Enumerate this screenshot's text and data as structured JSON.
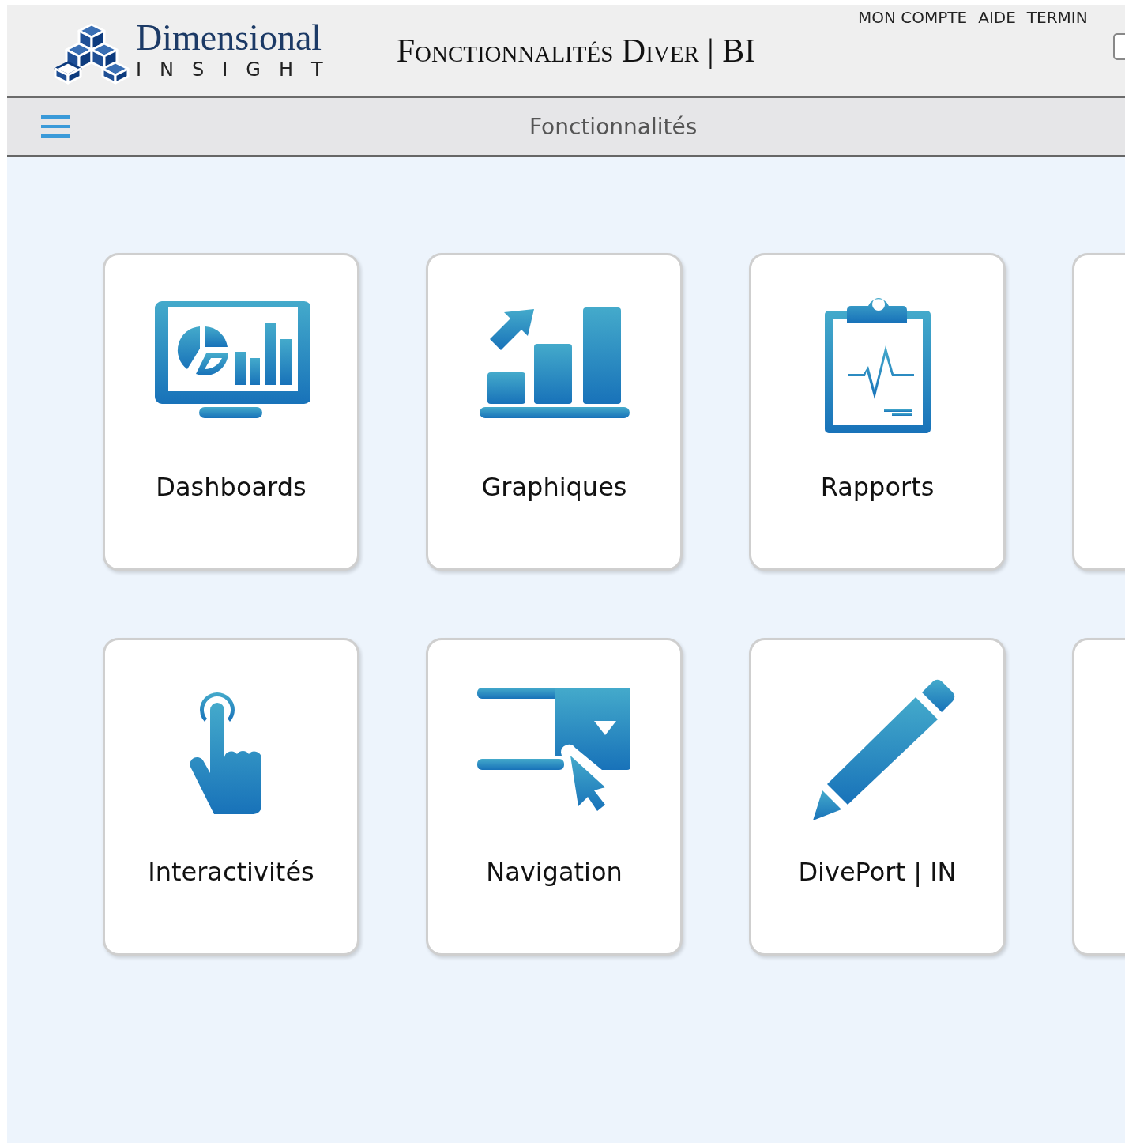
{
  "header": {
    "logo_word": "Dimensional",
    "logo_sub": "INSIGHT",
    "title": "Fonctionnalités Diver | BI",
    "links": [
      "MON COMPTE",
      "AIDE",
      "TERMIN"
    ]
  },
  "navbar": {
    "title": "Fonctionnalités"
  },
  "tiles": [
    {
      "kind": "dashboard",
      "label": "Dashboards"
    },
    {
      "kind": "chart",
      "label": "Graphiques"
    },
    {
      "kind": "report",
      "label": "Rapports"
    },
    {
      "kind": "cut"
    },
    {
      "kind": "touch",
      "label": "Interactivités"
    },
    {
      "kind": "navigation",
      "label": "Navigation"
    },
    {
      "kind": "pencil",
      "label": "DivePort | IN"
    },
    {
      "kind": "cut"
    }
  ]
}
